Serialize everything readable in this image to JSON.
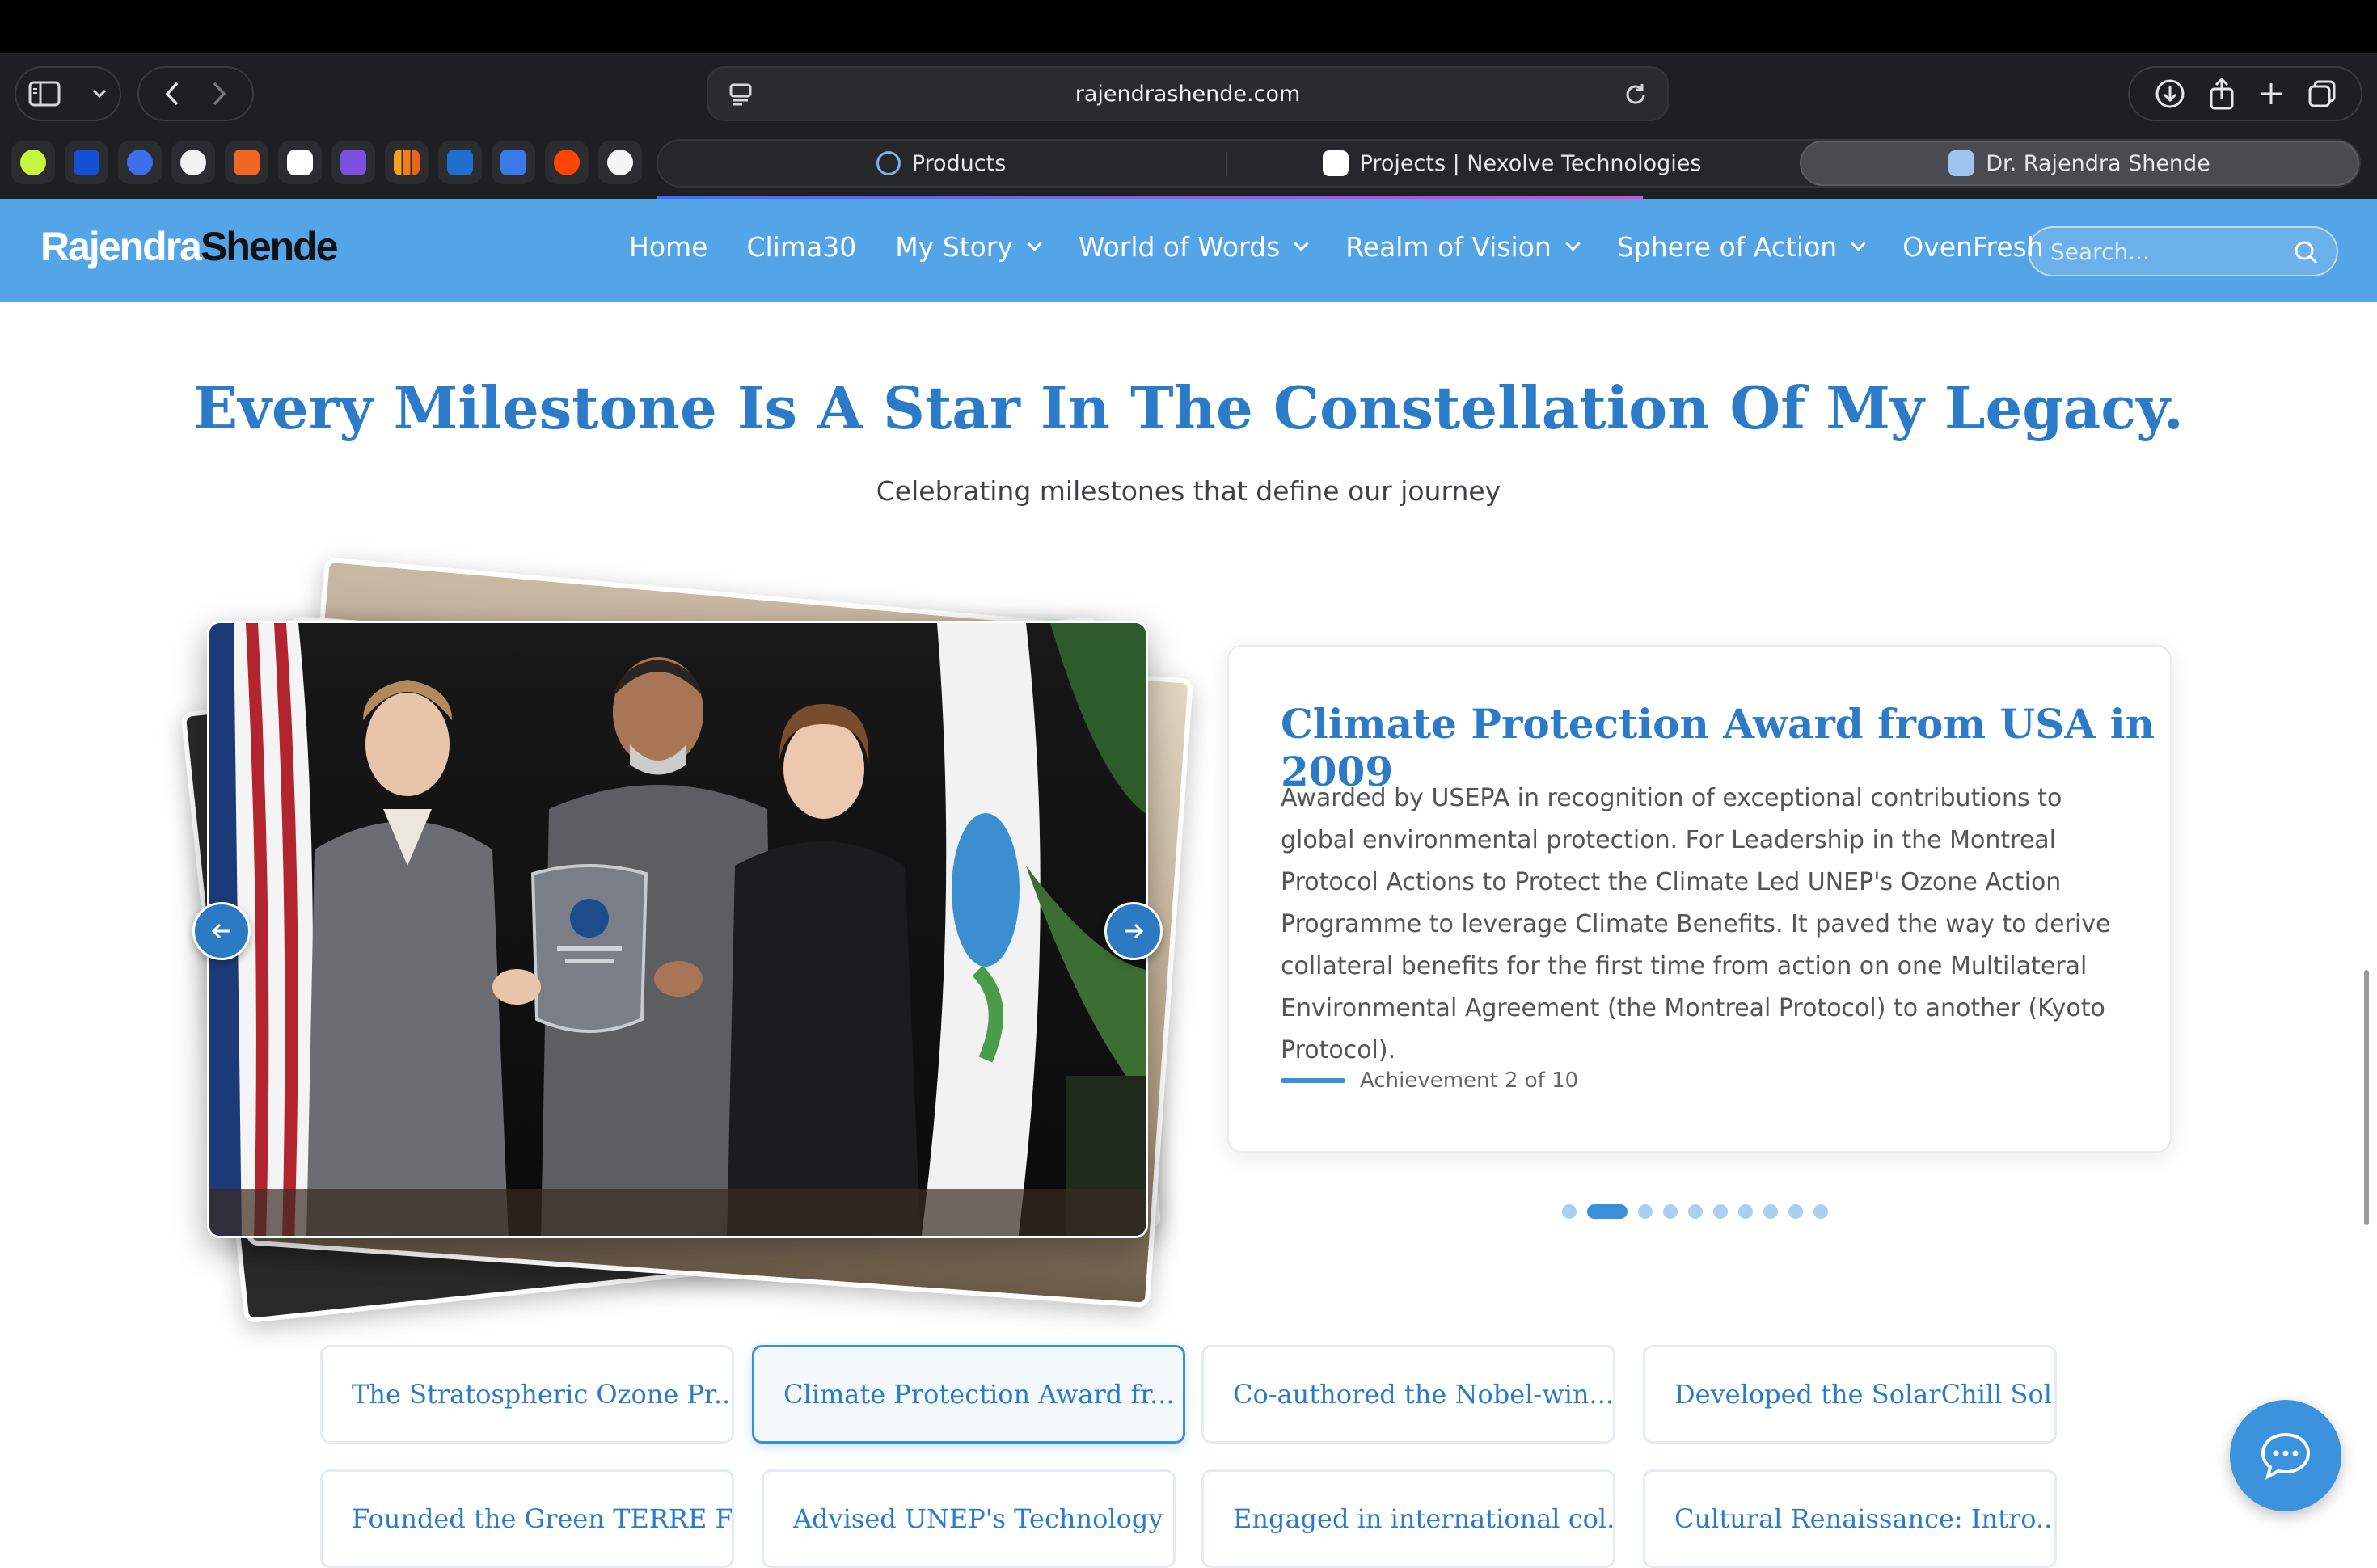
{
  "browser": {
    "url": "rajendrashende.com",
    "tabs": [
      {
        "label": "Products",
        "active": false
      },
      {
        "label": "Projects | Nexolve Technologies",
        "active": false
      },
      {
        "label": "Dr. Rajendra Shende",
        "active": true
      }
    ],
    "favorites": [
      "perplexity-icon",
      "p-icon",
      "linear-icon",
      "chatgpt-icon",
      "ycombinator-icon",
      "arc-icon",
      "sequence-icon",
      "analytics-icon",
      "linkedin-icon",
      "mail-icon",
      "reddit-icon",
      "medium-icon"
    ]
  },
  "site": {
    "logo_part1": "Rajendra",
    "logo_part2": "Shende",
    "nav": [
      {
        "label": "Home",
        "dropdown": false
      },
      {
        "label": "Clima30",
        "dropdown": false
      },
      {
        "label": "My Story",
        "dropdown": true
      },
      {
        "label": "World of Words",
        "dropdown": true
      },
      {
        "label": "Realm of Vision",
        "dropdown": true
      },
      {
        "label": "Sphere of Action",
        "dropdown": true
      },
      {
        "label": "OvenFresh",
        "dropdown": false
      }
    ],
    "search_placeholder": "Search..."
  },
  "hero": {
    "title": "Every Milestone Is A Star In The Constellation Of My Legacy.",
    "subtitle": "Celebrating milestones that define our journey"
  },
  "achievement": {
    "title": "Climate Protection Award from USA in 2009",
    "description": "Awarded by USEPA in recognition of exceptional contributions to global environmental protection. For Leadership in the Montreal Protocol Actions to Protect the Climate Led UNEP's Ozone Action Programme to leverage Climate Benefits. It paved the way to derive collateral benefits for the first time from action on one Multilateral Environmental Agreement (the Montreal Protocol) to another (Kyoto Protocol).",
    "counter": "Achievement 2 of 10",
    "current": 2,
    "total": 10
  },
  "thumbnails": [
    "The Stratospheric Ozone Pr...",
    "Climate Protection Award fr...",
    "Co-authored the Nobel-win...",
    "Developed the SolarChill Sol...",
    "Founded the Green TERRE F...",
    "Advised UNEP's Technology ...",
    "Engaged in international col...",
    "Cultural Renaissance: Intro..."
  ],
  "colors": {
    "accent": "#2b7bc8",
    "nav_bg": "#54a4e8",
    "chrome_bg": "#1e1f22"
  }
}
